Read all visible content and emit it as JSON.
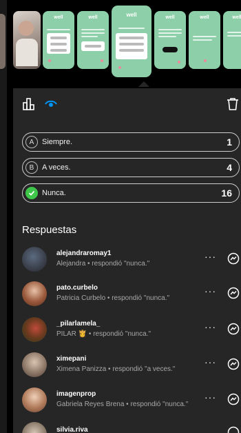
{
  "carousel": {
    "brand": "well",
    "slides": [
      "photo",
      "template",
      "template",
      "active",
      "template",
      "template",
      "template"
    ],
    "accent_color": "#8ccfa8"
  },
  "toolbar": {
    "stats_icon": "bar-chart-icon",
    "views_icon": "eye-icon",
    "delete_icon": "trash-icon",
    "active_color": "#0095f6"
  },
  "options": [
    {
      "letter": "A",
      "label": "Siempre.",
      "count": "1",
      "selected": false
    },
    {
      "letter": "B",
      "label": "A veces.",
      "count": "4",
      "selected": false
    },
    {
      "letter": "",
      "label": "Nunca.",
      "count": "16",
      "selected": true
    }
  ],
  "responses_title": "Respuestas",
  "responses": [
    {
      "username": "alejandraromay1",
      "detail": "Alejandra • respondió \"nunca.\""
    },
    {
      "username": "pato.curbelo",
      "detail": "Patricia Curbelo • respondió \"nunca.\""
    },
    {
      "username": "_pilarlamela_",
      "detail": "PILAR 👸 • respondió \"nunca.\""
    },
    {
      "username": "ximepani",
      "detail": "Ximena Panizza • respondió \"a veces.\""
    },
    {
      "username": "imagenprop",
      "detail": "Gabriela Reyes Brena • respondió \"nunca.\""
    },
    {
      "username": "silvia.riva",
      "detail": ""
    }
  ],
  "more_label": "···"
}
